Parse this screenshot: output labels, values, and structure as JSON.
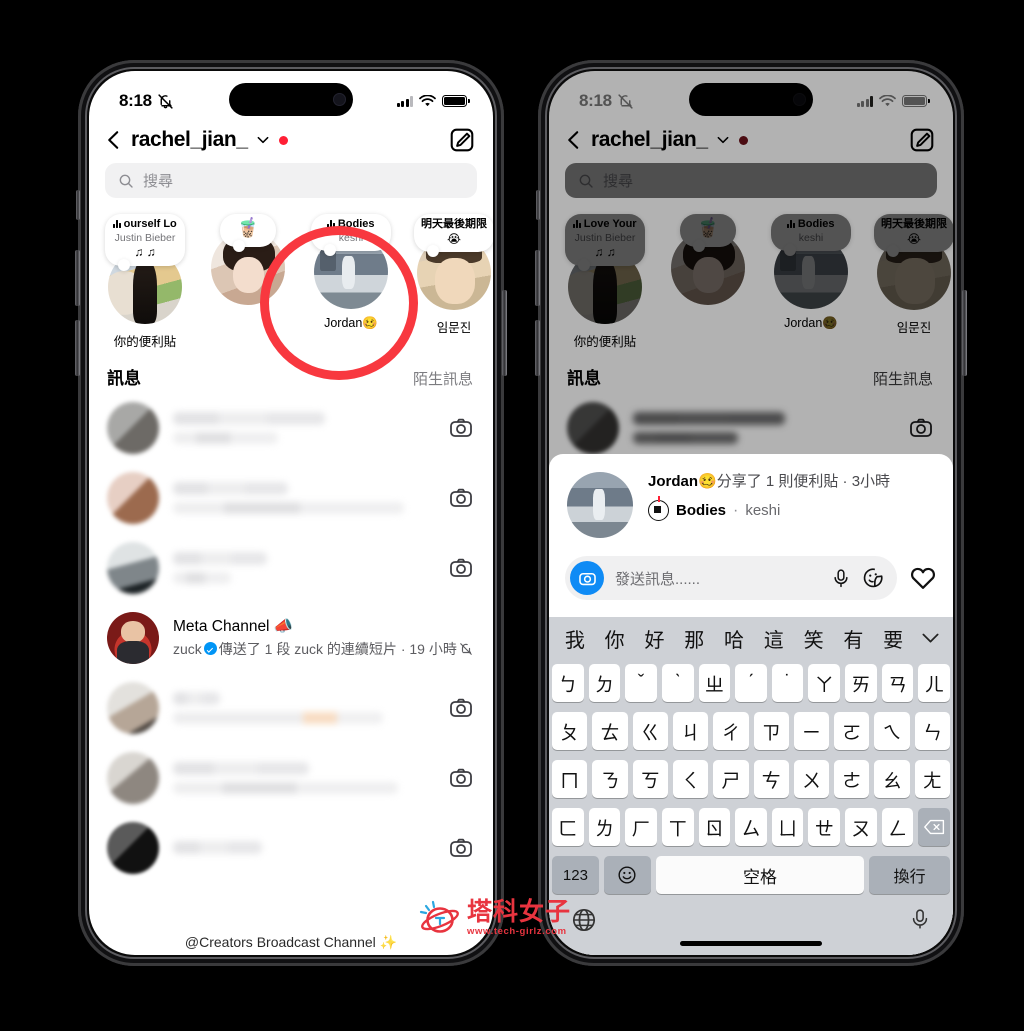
{
  "status_bar": {
    "time": "8:18",
    "silent_icon": "bell-slash-icon",
    "signal": "cellular-bars-icon",
    "wifi": "wifi-icon",
    "battery": "battery-icon"
  },
  "header": {
    "back": "back-chevron",
    "username": "rachel_jian_",
    "caret": "chevron-down-icon",
    "unread_dot": true,
    "compose": "compose-icon"
  },
  "search": {
    "placeholder": "搜尋",
    "icon": "search-icon"
  },
  "notes": {
    "items": [
      {
        "song": "ourself   Lo",
        "artist": "Justin Bieber",
        "emoji": "♫ ♫",
        "name": "你的便利貼",
        "has_music": true
      },
      {
        "song": "",
        "artist": "",
        "emoji": "🧋",
        "name": "",
        "has_music": false
      },
      {
        "song": "Bodies",
        "artist": "keshi",
        "emoji": "",
        "name": "Jordan🥴",
        "has_music": true
      },
      {
        "song": "明天最後期限",
        "artist": "",
        "emoji": "😭",
        "name": "임문진",
        "has_music": false
      }
    ]
  },
  "sections": {
    "messages": "訊息",
    "requests": "陌生訊息"
  },
  "chats": [
    {
      "name": "",
      "preview": "",
      "blurred": true
    },
    {
      "name": "",
      "preview": "",
      "blurred": true
    },
    {
      "name": "",
      "preview": "",
      "blurred": true
    },
    {
      "name": "Meta Channel 📣",
      "preview_prefix": "zuck ",
      "preview": "傳送了 1 段 zuck 的連續短片 · 19 小時",
      "blurred": false,
      "verified": true,
      "muted_icon": "bell-slash-icon"
    },
    {
      "name": "",
      "preview": "",
      "blurred": true
    },
    {
      "name": "",
      "preview": "",
      "blurred": true
    },
    {
      "name": "",
      "preview": "",
      "blurred": true
    }
  ],
  "broadcast_footer": "@Creators Broadcast Channel ✨",
  "note_sheet": {
    "author": "Jordan",
    "author_emoji": "🥴",
    "action": "分享了 1 則便利貼 · 3小時",
    "song": "Bodies",
    "separator": "·",
    "artist": "keshi",
    "composer": {
      "camera_icon": "camera-icon",
      "placeholder": "發送訊息......",
      "mic_icon": "microphone-icon",
      "sticker_icon": "sticker-icon",
      "like_icon": "heart-icon"
    }
  },
  "keyboard": {
    "predictions": [
      "我",
      "你",
      "好",
      "那",
      "哈",
      "這",
      "笑",
      "有",
      "要"
    ],
    "collapse_icon": "chevron-down-icon",
    "row1": [
      "ㄅ",
      "ㄉ",
      "ˇ",
      "ˋ",
      "ㄓ",
      "ˊ",
      "˙",
      "ㄚ",
      "ㄞ",
      "ㄢ",
      "ㄦ"
    ],
    "row2": [
      "ㄆ",
      "ㄊ",
      "ㄍ",
      "ㄐ",
      "ㄔ",
      "ㄗ",
      "ㄧ",
      "ㄛ",
      "ㄟ",
      "ㄣ"
    ],
    "row3": [
      "ㄇ",
      "ㄋ",
      "ㄎ",
      "ㄑ",
      "ㄕ",
      "ㄘ",
      "ㄨ",
      "ㄜ",
      "ㄠ",
      "ㄤ"
    ],
    "row4": [
      "ㄈ",
      "ㄌ",
      "ㄏ",
      "ㄒ",
      "ㄖ",
      "ㄙ",
      "ㄩ",
      "ㄝ",
      "ㄡ",
      "ㄥ"
    ],
    "backspace_icon": "backspace-icon",
    "numeric_key": "123",
    "emoji_key": "emoji-icon",
    "space_key": "空格",
    "return_key": "換行",
    "globe_icon": "globe-icon",
    "dictation_icon": "microphone-icon"
  },
  "watermark": {
    "name": "塔科女子",
    "url": "www.tech-girlz.com"
  },
  "annotation": {
    "type": "red-circle",
    "color": "#f8383f",
    "targets": "Jordan note"
  }
}
